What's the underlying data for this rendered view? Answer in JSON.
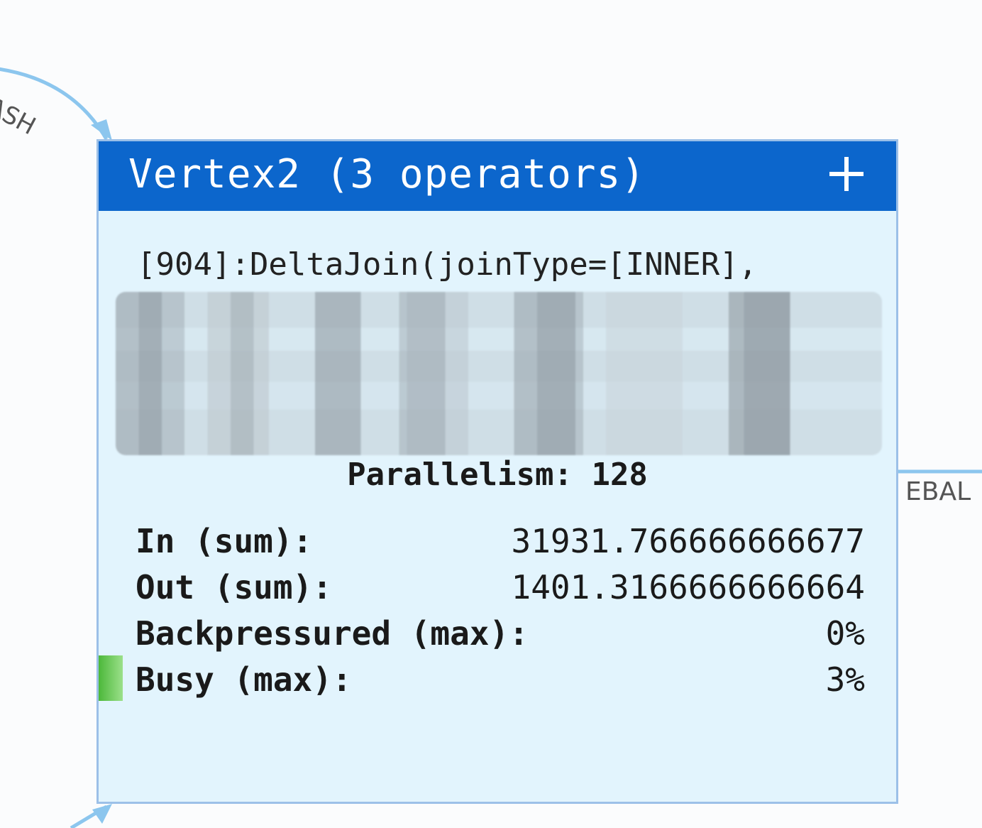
{
  "edges": {
    "incoming_label": "HASH",
    "outgoing_label": "EBAL"
  },
  "vertex": {
    "title": "Vertex2 (3 operators)",
    "expand_icon": "plus-icon",
    "operator_text": "[904]:DeltaJoin(joinType=[INNER],",
    "parallelism_text": "Parallelism: 128",
    "metrics": [
      {
        "label": "In (sum):",
        "value": "31931.766666666677"
      },
      {
        "label": "Out (sum):",
        "value": "1401.3166666666664"
      },
      {
        "label": "Backpressured (max):",
        "value": "0%"
      },
      {
        "label": "Busy (max):",
        "value": "3%"
      }
    ],
    "busy_fraction": 0.03,
    "colors": {
      "header": "#0c66cc",
      "body": "#e2f4fd",
      "border": "#9cc0e8",
      "busy_indicator": "#4cb83a",
      "edge": "#8cc6ee"
    }
  }
}
